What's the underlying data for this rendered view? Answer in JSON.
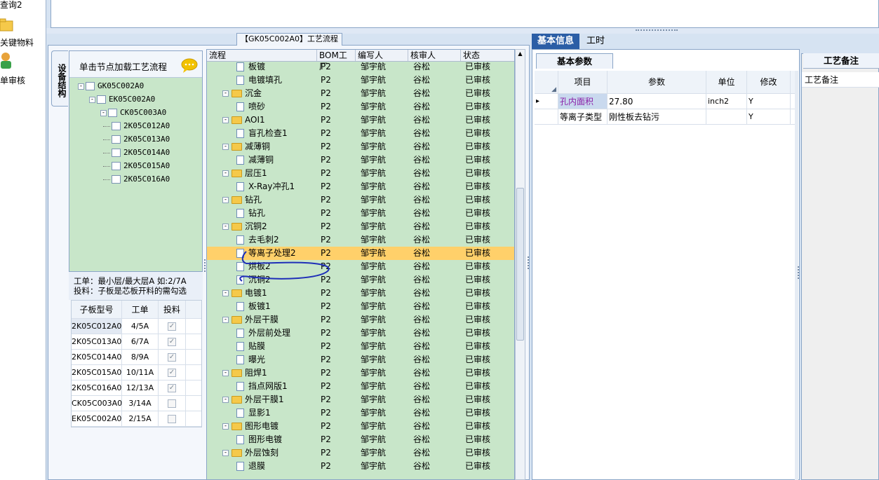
{
  "left_nav": {
    "items": [
      {
        "label": "查询2",
        "icon": "search-icon"
      },
      {
        "label": "关键物料",
        "icon": "folder-icon"
      },
      {
        "label": "单审核",
        "icon": "user-icon"
      }
    ]
  },
  "main_tab": {
    "label": "【GK05C002A0】工艺流程"
  },
  "side_vtab": {
    "label": "设备结构"
  },
  "tree": {
    "hint": "单击节点加载工艺流程",
    "nodes": [
      {
        "label": "GK05C002A0",
        "level": 0,
        "expander": "-"
      },
      {
        "label": "EK05C002A0",
        "level": 1,
        "expander": "-"
      },
      {
        "label": "CK05C003A0",
        "level": 2,
        "expander": "-"
      },
      {
        "label": "2K05C012A0",
        "level": 3,
        "expander": ""
      },
      {
        "label": "2K05C013A0",
        "level": 3,
        "expander": ""
      },
      {
        "label": "2K05C014A0",
        "level": 3,
        "expander": ""
      },
      {
        "label": "2K05C015A0",
        "level": 3,
        "expander": ""
      },
      {
        "label": "2K05C016A0",
        "level": 3,
        "expander": ""
      }
    ]
  },
  "info": {
    "line1": "工单：最小层/最大层A 如:2/7A",
    "line2": "投料：子板是芯板开料的需勾选"
  },
  "subboard_grid": {
    "headers": [
      "子板型号",
      "工单",
      "投料"
    ],
    "rows": [
      {
        "model": "2K05C012A0",
        "order": "4/5A",
        "feed": true
      },
      {
        "model": "2K05C013A0",
        "order": "6/7A",
        "feed": true
      },
      {
        "model": "2K05C014A0",
        "order": "8/9A",
        "feed": true
      },
      {
        "model": "2K05C015A0",
        "order": "10/11A",
        "feed": true
      },
      {
        "model": "2K05C016A0",
        "order": "12/13A",
        "feed": true
      },
      {
        "model": "CK05C003A0",
        "order": "3/14A",
        "feed": false
      },
      {
        "model": "EK05C002A0",
        "order": "2/15A",
        "feed": false
      }
    ]
  },
  "process_grid": {
    "headers": [
      "流程",
      "BOM工厂",
      "编写人",
      "核审人",
      "状态"
    ],
    "rows": [
      {
        "name": "板镀",
        "type": "doc",
        "bom": "P2",
        "writer": "邹宇航",
        "reviewer": "谷松",
        "status": "已审核"
      },
      {
        "name": "电镀填孔",
        "type": "doc",
        "bom": "P2",
        "writer": "邹宇航",
        "reviewer": "谷松",
        "status": "已审核"
      },
      {
        "name": "沉金",
        "type": "folder",
        "bom": "P2",
        "writer": "邹宇航",
        "reviewer": "谷松",
        "status": "已审核"
      },
      {
        "name": "喷砂",
        "type": "doc",
        "bom": "P2",
        "writer": "邹宇航",
        "reviewer": "谷松",
        "status": "已审核"
      },
      {
        "name": "AOI1",
        "type": "folder",
        "bom": "P2",
        "writer": "邹宇航",
        "reviewer": "谷松",
        "status": "已审核"
      },
      {
        "name": "盲孔检查1",
        "type": "doc",
        "bom": "P2",
        "writer": "邹宇航",
        "reviewer": "谷松",
        "status": "已审核"
      },
      {
        "name": "减薄铜",
        "type": "folder",
        "bom": "P2",
        "writer": "邹宇航",
        "reviewer": "谷松",
        "status": "已审核"
      },
      {
        "name": "减薄铜",
        "type": "doc",
        "bom": "P2",
        "writer": "邹宇航",
        "reviewer": "谷松",
        "status": "已审核"
      },
      {
        "name": "层压1",
        "type": "folder",
        "bom": "P2",
        "writer": "邹宇航",
        "reviewer": "谷松",
        "status": "已审核"
      },
      {
        "name": "X-Ray冲孔1",
        "type": "doc",
        "bom": "P2",
        "writer": "邹宇航",
        "reviewer": "谷松",
        "status": "已审核"
      },
      {
        "name": "钻孔",
        "type": "folder",
        "bom": "P2",
        "writer": "邹宇航",
        "reviewer": "谷松",
        "status": "已审核"
      },
      {
        "name": "钻孔",
        "type": "doc",
        "bom": "P2",
        "writer": "邹宇航",
        "reviewer": "谷松",
        "status": "已审核"
      },
      {
        "name": "沉铜2",
        "type": "folder",
        "bom": "P2",
        "writer": "邹宇航",
        "reviewer": "谷松",
        "status": "已审核"
      },
      {
        "name": "去毛刺2",
        "type": "doc",
        "bom": "P2",
        "writer": "邹宇航",
        "reviewer": "谷松",
        "status": "已审核"
      },
      {
        "name": "等离子处理2",
        "type": "doc",
        "bom": "P2",
        "writer": "邹宇航",
        "reviewer": "谷松",
        "status": "已审核",
        "selected": true
      },
      {
        "name": "烘板2",
        "type": "doc",
        "bom": "P2",
        "writer": "邹宇航",
        "reviewer": "谷松",
        "status": "已审核"
      },
      {
        "name": "沉铜2",
        "type": "doc",
        "bom": "P2",
        "writer": "邹宇航",
        "reviewer": "谷松",
        "status": "已审核"
      },
      {
        "name": "电镀1",
        "type": "folder",
        "bom": "P2",
        "writer": "邹宇航",
        "reviewer": "谷松",
        "status": "已审核"
      },
      {
        "name": "板镀1",
        "type": "doc",
        "bom": "P2",
        "writer": "邹宇航",
        "reviewer": "谷松",
        "status": "已审核"
      },
      {
        "name": "外层干膜",
        "type": "folder",
        "bom": "P2",
        "writer": "邹宇航",
        "reviewer": "谷松",
        "status": "已审核"
      },
      {
        "name": "外层前处理",
        "type": "doc",
        "bom": "P2",
        "writer": "邹宇航",
        "reviewer": "谷松",
        "status": "已审核"
      },
      {
        "name": "贴膜",
        "type": "doc",
        "bom": "P2",
        "writer": "邹宇航",
        "reviewer": "谷松",
        "status": "已审核"
      },
      {
        "name": "曝光",
        "type": "doc",
        "bom": "P2",
        "writer": "邹宇航",
        "reviewer": "谷松",
        "status": "已审核"
      },
      {
        "name": "阻焊1",
        "type": "folder",
        "bom": "P2",
        "writer": "邹宇航",
        "reviewer": "谷松",
        "status": "已审核"
      },
      {
        "name": "挡点网版1",
        "type": "doc",
        "bom": "P2",
        "writer": "邹宇航",
        "reviewer": "谷松",
        "status": "已审核"
      },
      {
        "name": "外层干膜1",
        "type": "folder",
        "bom": "P2",
        "writer": "邹宇航",
        "reviewer": "谷松",
        "status": "已审核"
      },
      {
        "name": "显影1",
        "type": "doc",
        "bom": "P2",
        "writer": "邹宇航",
        "reviewer": "谷松",
        "status": "已审核"
      },
      {
        "name": "图形电镀",
        "type": "folder",
        "bom": "P2",
        "writer": "邹宇航",
        "reviewer": "谷松",
        "status": "已审核"
      },
      {
        "name": "图形电镀",
        "type": "doc",
        "bom": "P2",
        "writer": "邹宇航",
        "reviewer": "谷松",
        "status": "已审核"
      },
      {
        "name": "外层蚀刻",
        "type": "folder",
        "bom": "P2",
        "writer": "邹宇航",
        "reviewer": "谷松",
        "status": "已审核"
      },
      {
        "name": "退膜",
        "type": "doc",
        "bom": "P2",
        "writer": "邹宇航",
        "reviewer": "谷松",
        "status": "已审核"
      }
    ]
  },
  "right_tabs": {
    "basic": "基本信息",
    "hours": "工时"
  },
  "params_tab": {
    "label": "基本参数"
  },
  "param_grid": {
    "headers": [
      "项目",
      "参数",
      "单位",
      "修改"
    ],
    "rows": [
      {
        "item": "孔内面积",
        "value": "27.80",
        "unit": "inch2",
        "edit": "Y"
      },
      {
        "item": "等离子类型",
        "value": "刚性板去钻污",
        "unit": "",
        "edit": "Y"
      }
    ]
  },
  "notes": {
    "tab": "工艺备注",
    "header": "工艺备注"
  },
  "colors": {
    "selection": "#ffd06a",
    "grid_bg": "#c8e6c9",
    "tab_active": "#2b5ea6",
    "annotation": "#1f2fb8"
  }
}
